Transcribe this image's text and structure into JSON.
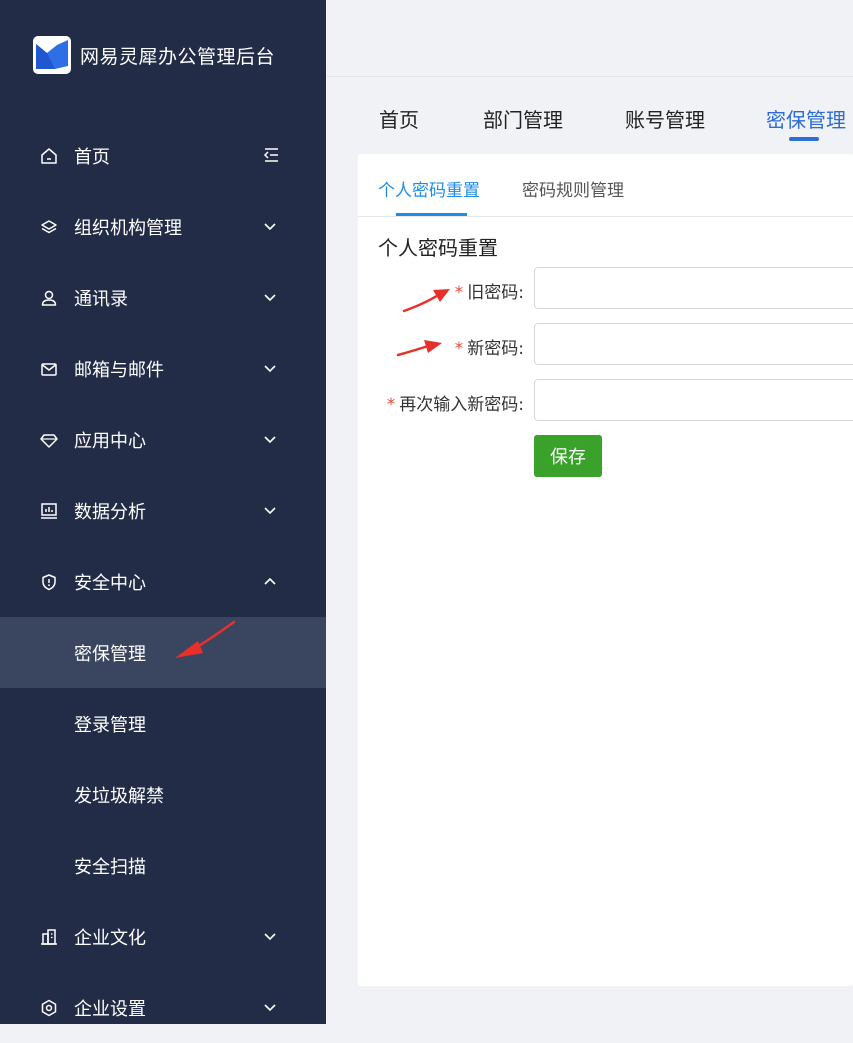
{
  "brand": {
    "title": "网易灵犀办公管理后台",
    "logo_icon": "lingxi-logo-icon"
  },
  "sidebar": {
    "items": [
      {
        "label": "首页",
        "icon": "home-icon",
        "extra": "collapse-icon"
      },
      {
        "label": "组织机构管理",
        "icon": "layers-icon",
        "arrow": "chevron-down-icon"
      },
      {
        "label": "通讯录",
        "icon": "user-icon",
        "arrow": "chevron-down-icon"
      },
      {
        "label": "邮箱与邮件",
        "icon": "mail-icon",
        "arrow": "chevron-down-icon"
      },
      {
        "label": "应用中心",
        "icon": "diamond-icon",
        "arrow": "chevron-down-icon"
      },
      {
        "label": "数据分析",
        "icon": "monitor-chart-icon",
        "arrow": "chevron-down-icon"
      },
      {
        "label": "安全中心",
        "icon": "shield-icon",
        "arrow": "chevron-up-icon",
        "children": [
          {
            "label": "密保管理",
            "active": true
          },
          {
            "label": "登录管理"
          },
          {
            "label": "发垃圾解禁"
          },
          {
            "label": "安全扫描"
          }
        ]
      },
      {
        "label": "企业文化",
        "icon": "building-icon",
        "arrow": "chevron-down-icon"
      },
      {
        "label": "企业设置",
        "icon": "gear-icon",
        "arrow": "chevron-down-icon"
      }
    ]
  },
  "navtabs": [
    {
      "label": "首页"
    },
    {
      "label": "部门管理"
    },
    {
      "label": "账号管理"
    },
    {
      "label": "密保管理",
      "active": true
    }
  ],
  "subtabs": [
    {
      "label": "个人密码重置",
      "active": true
    },
    {
      "label": "密码规则管理"
    }
  ],
  "form": {
    "title": "个人密码重置",
    "required_mark": "*",
    "fields": [
      {
        "label": "旧密码:",
        "value": ""
      },
      {
        "label": "新密码:",
        "value": ""
      },
      {
        "label": "再次输入新密码:",
        "value": ""
      }
    ],
    "save_label": "保存"
  },
  "colors": {
    "sidebar_bg": "#232c47",
    "sidebar_active": "#3a4560",
    "accent_blue": "#2c6cd6",
    "subtab_blue": "#1f8de8",
    "save_green": "#3aa12a",
    "required_red": "#e64a3b",
    "annotation_red": "#e8302a"
  }
}
